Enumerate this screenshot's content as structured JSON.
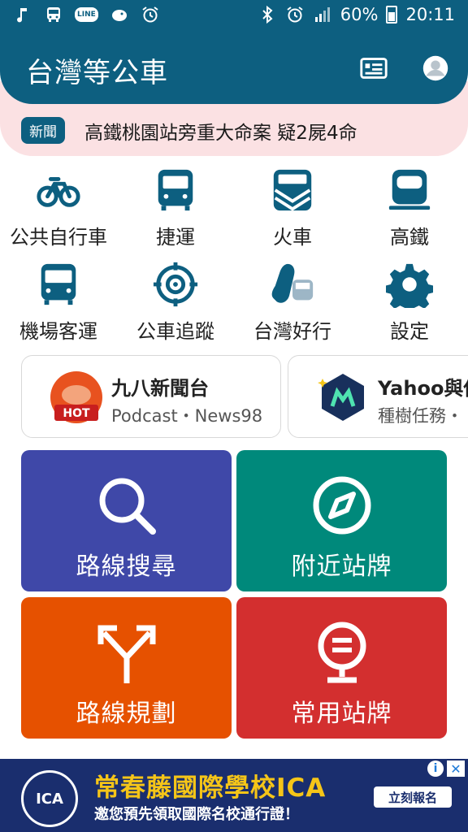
{
  "status_bar": {
    "battery": "60%",
    "time": "20:11",
    "left_icons": [
      "music-note-icon",
      "bus-icon",
      "line-app-icon",
      "bird-icon",
      "alarm-icon"
    ],
    "right_icons": [
      "bluetooth-icon",
      "alarm-icon",
      "signal-icon",
      "battery-icon"
    ],
    "line_label": "LINE"
  },
  "header": {
    "title": "台灣等公車",
    "icons": [
      "news-icon",
      "account-icon"
    ]
  },
  "news": {
    "tag": "新聞",
    "headline": "高鐵桃園站旁重大命案 疑2屍4命"
  },
  "quick_links": [
    {
      "label": "公共自行車",
      "icon": "bicycle-icon"
    },
    {
      "label": "捷運",
      "icon": "metro-icon"
    },
    {
      "label": "火車",
      "icon": "train-icon"
    },
    {
      "label": "高鐵",
      "icon": "high-speed-rail-icon"
    },
    {
      "label": "機場客運",
      "icon": "airport-bus-icon"
    },
    {
      "label": "公車追蹤",
      "icon": "bus-tracking-icon"
    },
    {
      "label": "台灣好行",
      "icon": "taiwan-tourist-shuttle-icon"
    },
    {
      "label": "設定",
      "icon": "gear-icon"
    }
  ],
  "cards": [
    {
      "title": "九八新聞台",
      "subtitle": "Podcast・News98",
      "badge": "HOT"
    },
    {
      "title": "Yahoo與你",
      "subtitle": "種樹任務・"
    }
  ],
  "tiles": [
    {
      "label": "路線搜尋",
      "icon": "search-icon",
      "color": "#3f48a8"
    },
    {
      "label": "附近站牌",
      "icon": "compass-icon",
      "color": "#00897b"
    },
    {
      "label": "路線規劃",
      "icon": "route-split-icon",
      "color": "#e65100"
    },
    {
      "label": "常用站牌",
      "icon": "bus-stop-icon",
      "color": "#d32f2f"
    }
  ],
  "ad": {
    "title": "常春藤國際學校ICA",
    "subtitle": "邀您預先領取國際名校通行證！",
    "cta": "立刻報名",
    "logo_text": "ICA"
  },
  "colors": {
    "primary": "#0d5f80",
    "news_bg": "#fbe1e3",
    "icon_blue": "#0d5f80"
  }
}
